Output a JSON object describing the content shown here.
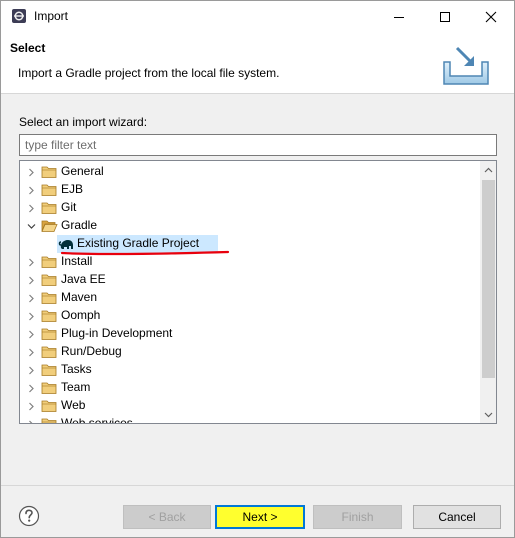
{
  "window": {
    "title": "Import",
    "controls": {
      "minimize": "minimize",
      "maximize": "maximize",
      "close": "close"
    }
  },
  "banner": {
    "title": "Select",
    "description": "Import a Gradle project from the local file system.",
    "icon": "import-wizard-icon"
  },
  "wizard": {
    "filter_label": "Select an import wizard:",
    "filter_placeholder": "type filter text",
    "filter_value": "",
    "tree": [
      {
        "label": "General",
        "expanded": false
      },
      {
        "label": "EJB",
        "expanded": false
      },
      {
        "label": "Git",
        "expanded": false
      },
      {
        "label": "Gradle",
        "expanded": true
      },
      {
        "label": "Existing Gradle Project",
        "child": true,
        "selected": true,
        "icon": "gradle-elephant-icon"
      },
      {
        "label": "Install",
        "expanded": false
      },
      {
        "label": "Java EE",
        "expanded": false
      },
      {
        "label": "Maven",
        "expanded": false
      },
      {
        "label": "Oomph",
        "expanded": false
      },
      {
        "label": "Plug-in Development",
        "expanded": false
      },
      {
        "label": "Run/Debug",
        "expanded": false
      },
      {
        "label": "Tasks",
        "expanded": false
      },
      {
        "label": "Team",
        "expanded": false
      },
      {
        "label": "Web",
        "expanded": false
      },
      {
        "label": "Web services",
        "expanded": false,
        "partially_visible": true
      }
    ],
    "annotation_color": "#e8000d",
    "selection_color": "#cce8ff"
  },
  "footer": {
    "help_icon": "help-icon",
    "back_label": "< Back",
    "next_label": "Next >",
    "finish_label": "Finish",
    "cancel_label": "Cancel",
    "next_highlight_color": "#ffff2e"
  }
}
